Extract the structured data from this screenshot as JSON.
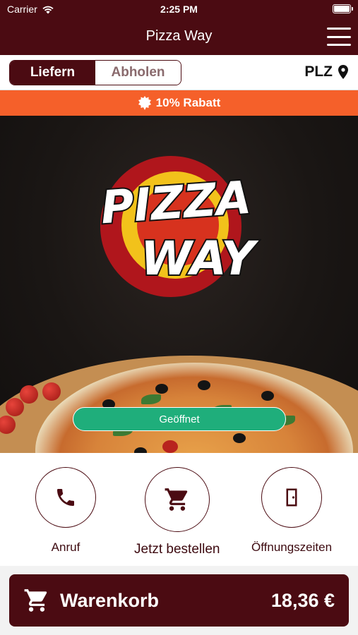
{
  "status_bar": {
    "carrier": "Carrier",
    "time": "2:25 PM"
  },
  "nav": {
    "title": "Pizza Way",
    "menu_icon": "hamburger-menu-icon"
  },
  "mode": {
    "options": [
      "Liefern",
      "Abholen"
    ],
    "selected": "Liefern",
    "plz_label": "PLZ",
    "plz_icon": "location-pin-icon"
  },
  "promo": {
    "text": "10% Rabatt",
    "icon": "badge-icon"
  },
  "hero": {
    "logo_text": [
      "PIZZA",
      "WAY"
    ],
    "status_label": "Geöffnet"
  },
  "actions": [
    {
      "label": "Anruf",
      "icon": "phone-icon"
    },
    {
      "label": "Jetzt bestellen",
      "icon": "cart-icon"
    },
    {
      "label": "Öffnungszeiten",
      "icon": "door-icon"
    }
  ],
  "cart": {
    "label": "Warenkorb",
    "total": "18,36 €",
    "icon": "cart-icon"
  },
  "colors": {
    "primary": "#4b0b12",
    "promo": "#f5602a",
    "open": "#1fae7b"
  }
}
